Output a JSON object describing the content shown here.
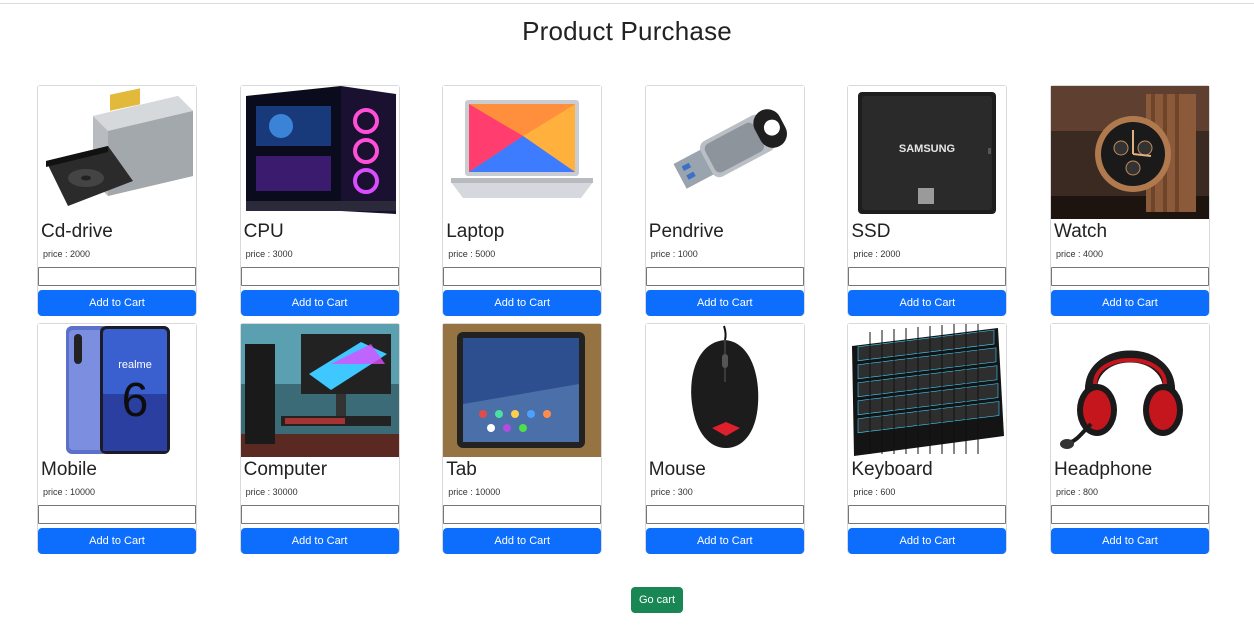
{
  "page": {
    "title": "Product Purchase",
    "go_cart_label": "Go cart"
  },
  "colors": {
    "primary_button": "#0d6efd",
    "success_button": "#198754"
  },
  "products": [
    {
      "name": "Cd-drive",
      "price": "price : 2000",
      "button": "Add to Cart",
      "icon": "cd-drive-image"
    },
    {
      "name": "CPU",
      "price": "price : 3000",
      "button": "Add to Cart",
      "icon": "cpu-image"
    },
    {
      "name": "Laptop",
      "price": "price : 5000",
      "button": "Add to Cart",
      "icon": "laptop-image"
    },
    {
      "name": "Pendrive",
      "price": "price : 1000",
      "button": "Add to Cart",
      "icon": "pendrive-image"
    },
    {
      "name": "SSD",
      "price": "price : 2000",
      "button": "Add to Cart",
      "icon": "ssd-image"
    },
    {
      "name": "Watch",
      "price": "price : 4000",
      "button": "Add to Cart",
      "icon": "watch-image"
    },
    {
      "name": "Mobile",
      "price": "price : 10000",
      "button": "Add to Cart",
      "icon": "mobile-image"
    },
    {
      "name": "Computer",
      "price": "price : 30000",
      "button": "Add to Cart",
      "icon": "computer-image"
    },
    {
      "name": "Tab",
      "price": "price : 10000",
      "button": "Add to Cart",
      "icon": "tablet-image"
    },
    {
      "name": "Mouse",
      "price": "price : 300",
      "button": "Add to Cart",
      "icon": "mouse-image"
    },
    {
      "name": "Keyboard",
      "price": "price : 600",
      "button": "Add to Cart",
      "icon": "keyboard-image"
    },
    {
      "name": "Headphone",
      "price": "price : 800",
      "button": "Add to Cart",
      "icon": "headphone-image"
    }
  ],
  "image_text": {
    "ssd_brand": "SAMSUNG",
    "phone_brand": "realme",
    "phone_model": "6"
  }
}
